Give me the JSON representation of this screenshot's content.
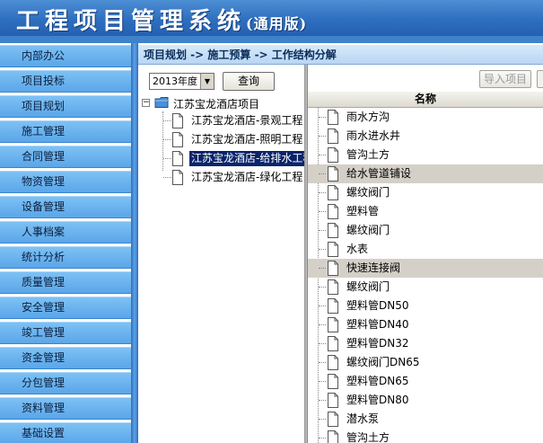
{
  "app": {
    "title": "工程项目管理系统",
    "subtitle": "(通用版)"
  },
  "sidebar": {
    "items": [
      {
        "label": "内部办公"
      },
      {
        "label": "项目投标"
      },
      {
        "label": "项目规划"
      },
      {
        "label": "施工管理"
      },
      {
        "label": "合同管理"
      },
      {
        "label": "物资管理"
      },
      {
        "label": "设备管理"
      },
      {
        "label": "人事档案"
      },
      {
        "label": "统计分析"
      },
      {
        "label": "质量管理"
      },
      {
        "label": "安全管理"
      },
      {
        "label": "竣工管理"
      },
      {
        "label": "资金管理"
      },
      {
        "label": "分包管理"
      },
      {
        "label": "资料管理"
      },
      {
        "label": "基础设置"
      }
    ]
  },
  "breadcrumb": {
    "text": "项目规划 -> 施工预算 -> 工作结构分解"
  },
  "filter": {
    "year_value": "2013年度",
    "query_label": "查询"
  },
  "tree": {
    "root": {
      "label": "江苏宝龙酒店项目",
      "expander": "−"
    },
    "children": [
      {
        "label": "江苏宝龙酒店-景观工程",
        "selected": false
      },
      {
        "label": "江苏宝龙酒店-照明工程",
        "selected": false
      },
      {
        "label": "江苏宝龙酒店-给排水工程",
        "selected": true
      },
      {
        "label": "江苏宝龙酒店-绿化工程",
        "selected": false
      }
    ]
  },
  "toolbar": {
    "import_label": "导入项目"
  },
  "list": {
    "header": "名称",
    "rows": [
      {
        "label": "雨水方沟",
        "highlighted": false
      },
      {
        "label": "雨水进水井",
        "highlighted": false
      },
      {
        "label": "管沟土方",
        "highlighted": false
      },
      {
        "label": "给水管道铺设",
        "highlighted": true
      },
      {
        "label": "螺纹阀门",
        "highlighted": false
      },
      {
        "label": "塑料管",
        "highlighted": false
      },
      {
        "label": "螺纹阀门",
        "highlighted": false
      },
      {
        "label": "水表",
        "highlighted": false
      },
      {
        "label": "快速连接阀",
        "highlighted": true
      },
      {
        "label": "螺纹阀门",
        "highlighted": false
      },
      {
        "label": "塑料管DN50",
        "highlighted": false
      },
      {
        "label": "塑料管DN40",
        "highlighted": false
      },
      {
        "label": "塑料管DN32",
        "highlighted": false
      },
      {
        "label": "螺纹阀门DN65",
        "highlighted": false
      },
      {
        "label": "塑料管DN65",
        "highlighted": false
      },
      {
        "label": "塑料管DN80",
        "highlighted": false
      },
      {
        "label": "潜水泵",
        "highlighted": false
      },
      {
        "label": "管沟土方",
        "highlighted": false
      }
    ]
  },
  "colors": {
    "header_blue": "#2f6fc0",
    "sidebar_item": "#5aa6e9",
    "selection": "#0a246a",
    "row_highlight": "#d4d0c8"
  }
}
